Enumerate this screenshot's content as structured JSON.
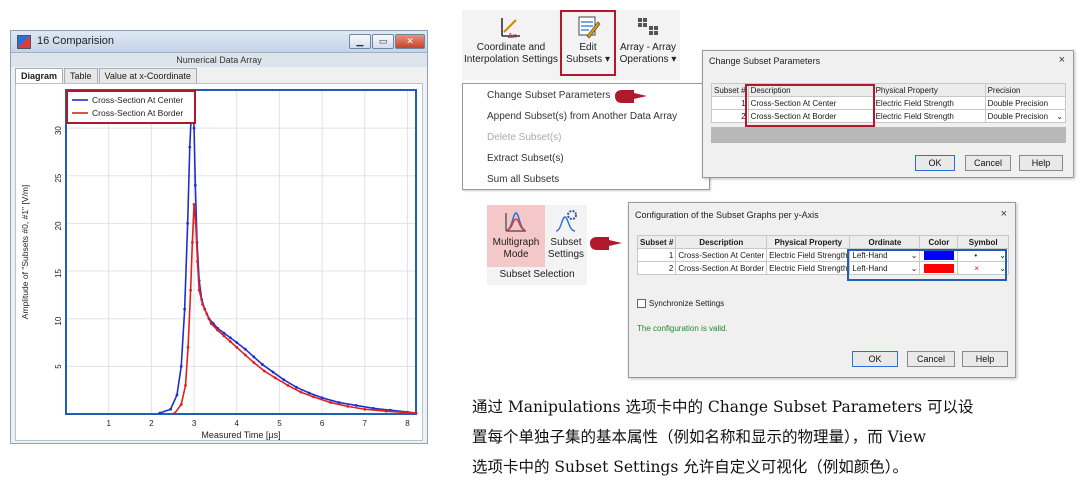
{
  "window": {
    "title": "16 Comparision",
    "header": "Numerical Data Array",
    "tabs": [
      "Diagram",
      "Table",
      "Value at x-Coordinate"
    ]
  },
  "chart_data": {
    "type": "line",
    "xlabel": "Measured Time [µs]",
    "ylabel": "Amplitude of \"Subsets #0, #1\" [V/m]",
    "xlim": [
      0,
      8.2
    ],
    "ylim": [
      0,
      34
    ],
    "xticks": [
      "1",
      "2",
      "3",
      "4",
      "5",
      "6",
      "7",
      "8"
    ],
    "yticks": [
      "5",
      "10",
      "15",
      "20",
      "25",
      "30"
    ],
    "grid": true,
    "legend_position": "top-left",
    "series": [
      {
        "name": "Cross-Section At Center",
        "color": "#1f2fcf",
        "x": [
          2.2,
          2.45,
          2.6,
          2.7,
          2.78,
          2.85,
          2.9,
          2.94,
          2.97,
          3.0,
          3.03,
          3.07,
          3.12,
          3.18,
          3.25,
          3.35,
          3.45,
          3.55,
          3.7,
          3.85,
          4.0,
          4.2,
          4.4,
          4.6,
          4.85,
          5.1,
          5.4,
          5.7,
          6.0,
          6.4,
          6.8,
          7.2,
          7.6,
          8.0,
          8.2
        ],
        "y": [
          0.1,
          0.5,
          2,
          5,
          11,
          20,
          28,
          32,
          33,
          30,
          24,
          18,
          14,
          12,
          11,
          10,
          9.5,
          9,
          8.5,
          8,
          7.5,
          6.8,
          6,
          5.2,
          4.4,
          3.6,
          2.8,
          2.2,
          1.7,
          1.2,
          0.9,
          0.6,
          0.4,
          0.2,
          0.1
        ]
      },
      {
        "name": "Cross-Section At Border",
        "color": "#e02020",
        "x": [
          2.55,
          2.7,
          2.8,
          2.86,
          2.92,
          2.96,
          3.0,
          3.04,
          3.08,
          3.12,
          3.2,
          3.3,
          3.4,
          3.55,
          3.7,
          3.85,
          4.0,
          4.2,
          4.4,
          4.65,
          4.9,
          5.2,
          5.5,
          5.8,
          6.2,
          6.6,
          7.0,
          7.5,
          8.0,
          8.2
        ],
        "y": [
          0.1,
          1,
          3,
          7,
          13,
          18,
          22,
          20,
          16,
          13,
          11.5,
          10.5,
          9.5,
          8.8,
          8.2,
          7.6,
          7,
          6.2,
          5.4,
          4.5,
          3.8,
          3,
          2.3,
          1.8,
          1.2,
          0.8,
          0.5,
          0.3,
          0.15,
          0.1
        ]
      }
    ]
  },
  "ribbon": {
    "coordinate": "Coordinate and Interpolation Settings",
    "edit_subsets": "Edit Subsets",
    "array_ops": "Array - Array Operations",
    "coordinate_l1": "Coordinate and",
    "coordinate_l2": "Interpolation Settings",
    "edit_l1": "Edit",
    "edit_l2": "Subsets ▾",
    "array_l1": "Array - Array",
    "array_l2": "Operations ▾"
  },
  "menu": {
    "items": [
      {
        "label": "Change Subset Parameters",
        "enabled": true
      },
      {
        "label": "Append Subset(s) from Another Data Array",
        "enabled": true
      },
      {
        "label": "Delete Subset(s)",
        "enabled": false
      },
      {
        "label": "Extract Subset(s)",
        "enabled": true
      },
      {
        "label": "Sum all Subsets",
        "enabled": true
      }
    ]
  },
  "dialog1": {
    "title": "Change Subset Parameters",
    "close": "×",
    "columns": [
      "Subset #",
      "Description",
      "Physical Property",
      "Precision"
    ],
    "rows": [
      [
        "1",
        "Cross-Section At Center",
        "Electric Field Strength",
        "Double Precision"
      ],
      [
        "2",
        "Cross-Section At Border",
        "Electric Field Strength",
        "Double Precision"
      ]
    ],
    "ok": "OK",
    "cancel": "Cancel",
    "help": "Help"
  },
  "subset_group": {
    "multigraph_l1": "Multigraph",
    "multigraph_l2": "Mode",
    "settings_l1": "Subset",
    "settings_l2": "Settings",
    "group_label": "Subset Selection"
  },
  "dialog2": {
    "title": "Configuration of the Subset Graphs per y-Axis",
    "close": "×",
    "columns": [
      "Subset #",
      "Description",
      "Physical Property",
      "Ordinate",
      "Color",
      "Symbol"
    ],
    "rows": [
      [
        "1",
        "Cross-Section At Center",
        "Electric Field Strength",
        "Left-Hand",
        "#0000ff",
        "•"
      ],
      [
        "2",
        "Cross-Section At Border",
        "Electric Field Strength",
        "Left-Hand",
        "#ff0000",
        "×"
      ]
    ],
    "sync": "Synchronize Settings",
    "valid": "The configuration is valid.",
    "ok": "OK",
    "cancel": "Cancel",
    "help": "Help"
  },
  "paragraph": {
    "line1": "通过 Manipulations 选项卡中的 Change Subset Parameters 可以设",
    "line2": "置每个单独子集的基本属性（例如名称和显示的物理量），而 View",
    "line3": "选项卡中的 Subset Settings 允许自定义可视化（例如颜色）。"
  }
}
